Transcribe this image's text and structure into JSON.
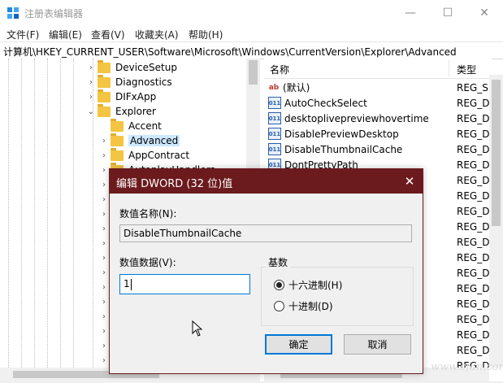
{
  "window": {
    "title": "注册表编辑器",
    "min_glyph": "—",
    "max_glyph": "☐",
    "close_glyph": "✕"
  },
  "menu": [
    "文件(F)",
    "编辑(E)",
    "查看(V)",
    "收藏夹(A)",
    "帮助(H)"
  ],
  "address": "计算机\\HKEY_CURRENT_USER\\Software\\Microsoft\\Windows\\CurrentVersion\\Explorer\\Advanced",
  "tree": {
    "items": [
      {
        "label": "DeviceSetup",
        "expanded": false
      },
      {
        "label": "Diagnostics",
        "expanded": false
      },
      {
        "label": "DIFxApp",
        "expanded": false
      },
      {
        "label": "Explorer",
        "expanded": true
      },
      {
        "label": "Accent",
        "expanded": false
      },
      {
        "label": "Advanced",
        "expanded": false,
        "selected": true
      },
      {
        "label": "AppContract",
        "expanded": false
      },
      {
        "label": "AutoplayHandlers",
        "expanded": false
      }
    ]
  },
  "list": {
    "col_name": "名称",
    "col_type": "类型",
    "rows": [
      {
        "icon": "string-value-icon",
        "icon_text": "ab",
        "name": "(默认)",
        "type": "REG_S"
      },
      {
        "icon": "binary-value-icon",
        "icon_text": "011",
        "name": "AutoCheckSelect",
        "type": "REG_D"
      },
      {
        "icon": "binary-value-icon",
        "icon_text": "011",
        "name": "desktoplivepreviewhovertime",
        "type": "REG_D"
      },
      {
        "icon": "binary-value-icon",
        "icon_text": "011",
        "name": "DisablePreviewDesktop",
        "type": "REG_D"
      },
      {
        "icon": "binary-value-icon",
        "icon_text": "011",
        "name": "DisableThumbnailCache",
        "type": "REG_D"
      },
      {
        "icon": "binary-value-icon",
        "icon_text": "011",
        "name": "DontPrettyPath",
        "type": "REG_D"
      },
      {
        "icon": "",
        "icon_text": "",
        "name": "",
        "type": "REG_D"
      },
      {
        "icon": "",
        "icon_text": "",
        "name": "",
        "type": "REG_D"
      },
      {
        "icon": "",
        "icon_text": "",
        "name": "",
        "type": "REG_D"
      },
      {
        "icon": "",
        "icon_text": "",
        "name": "",
        "type": "REG_D"
      },
      {
        "icon": "",
        "icon_text": "",
        "name": "",
        "type": "REG_D"
      },
      {
        "icon": "",
        "icon_text": "",
        "name": "",
        "type": "REG_D"
      },
      {
        "icon": "",
        "icon_text": "",
        "name": "",
        "type": "REG_D"
      },
      {
        "icon": "",
        "icon_text": "",
        "name": "",
        "type": "REG_D"
      },
      {
        "icon": "",
        "icon_text": "",
        "name": "",
        "type": "REG_D"
      },
      {
        "icon": "",
        "icon_text": "",
        "name": "",
        "type": "REG_D"
      },
      {
        "icon": "",
        "icon_text": "",
        "name": "",
        "type": "REG_D"
      },
      {
        "icon": "",
        "icon_text": "",
        "name": "",
        "type": "REG_D"
      },
      {
        "icon": "",
        "icon_text": "",
        "name": "",
        "type": "REG_D"
      }
    ]
  },
  "dialog": {
    "title": "编辑 DWORD (32 位)值",
    "close_glyph": "✕",
    "name_label": "数值名称(N):",
    "name_value": "DisableThumbnailCache",
    "data_label": "数值数据(V):",
    "data_value": "1",
    "base_label": "基数",
    "radio_hex": "十六进制(H)",
    "radio_dec": "十进制(D)",
    "selected_base": "hex",
    "ok_label": "确定",
    "cancel_label": "取消",
    "accent_color": "#6b1a1d"
  },
  "watermark": "www.cfan.com.cn"
}
